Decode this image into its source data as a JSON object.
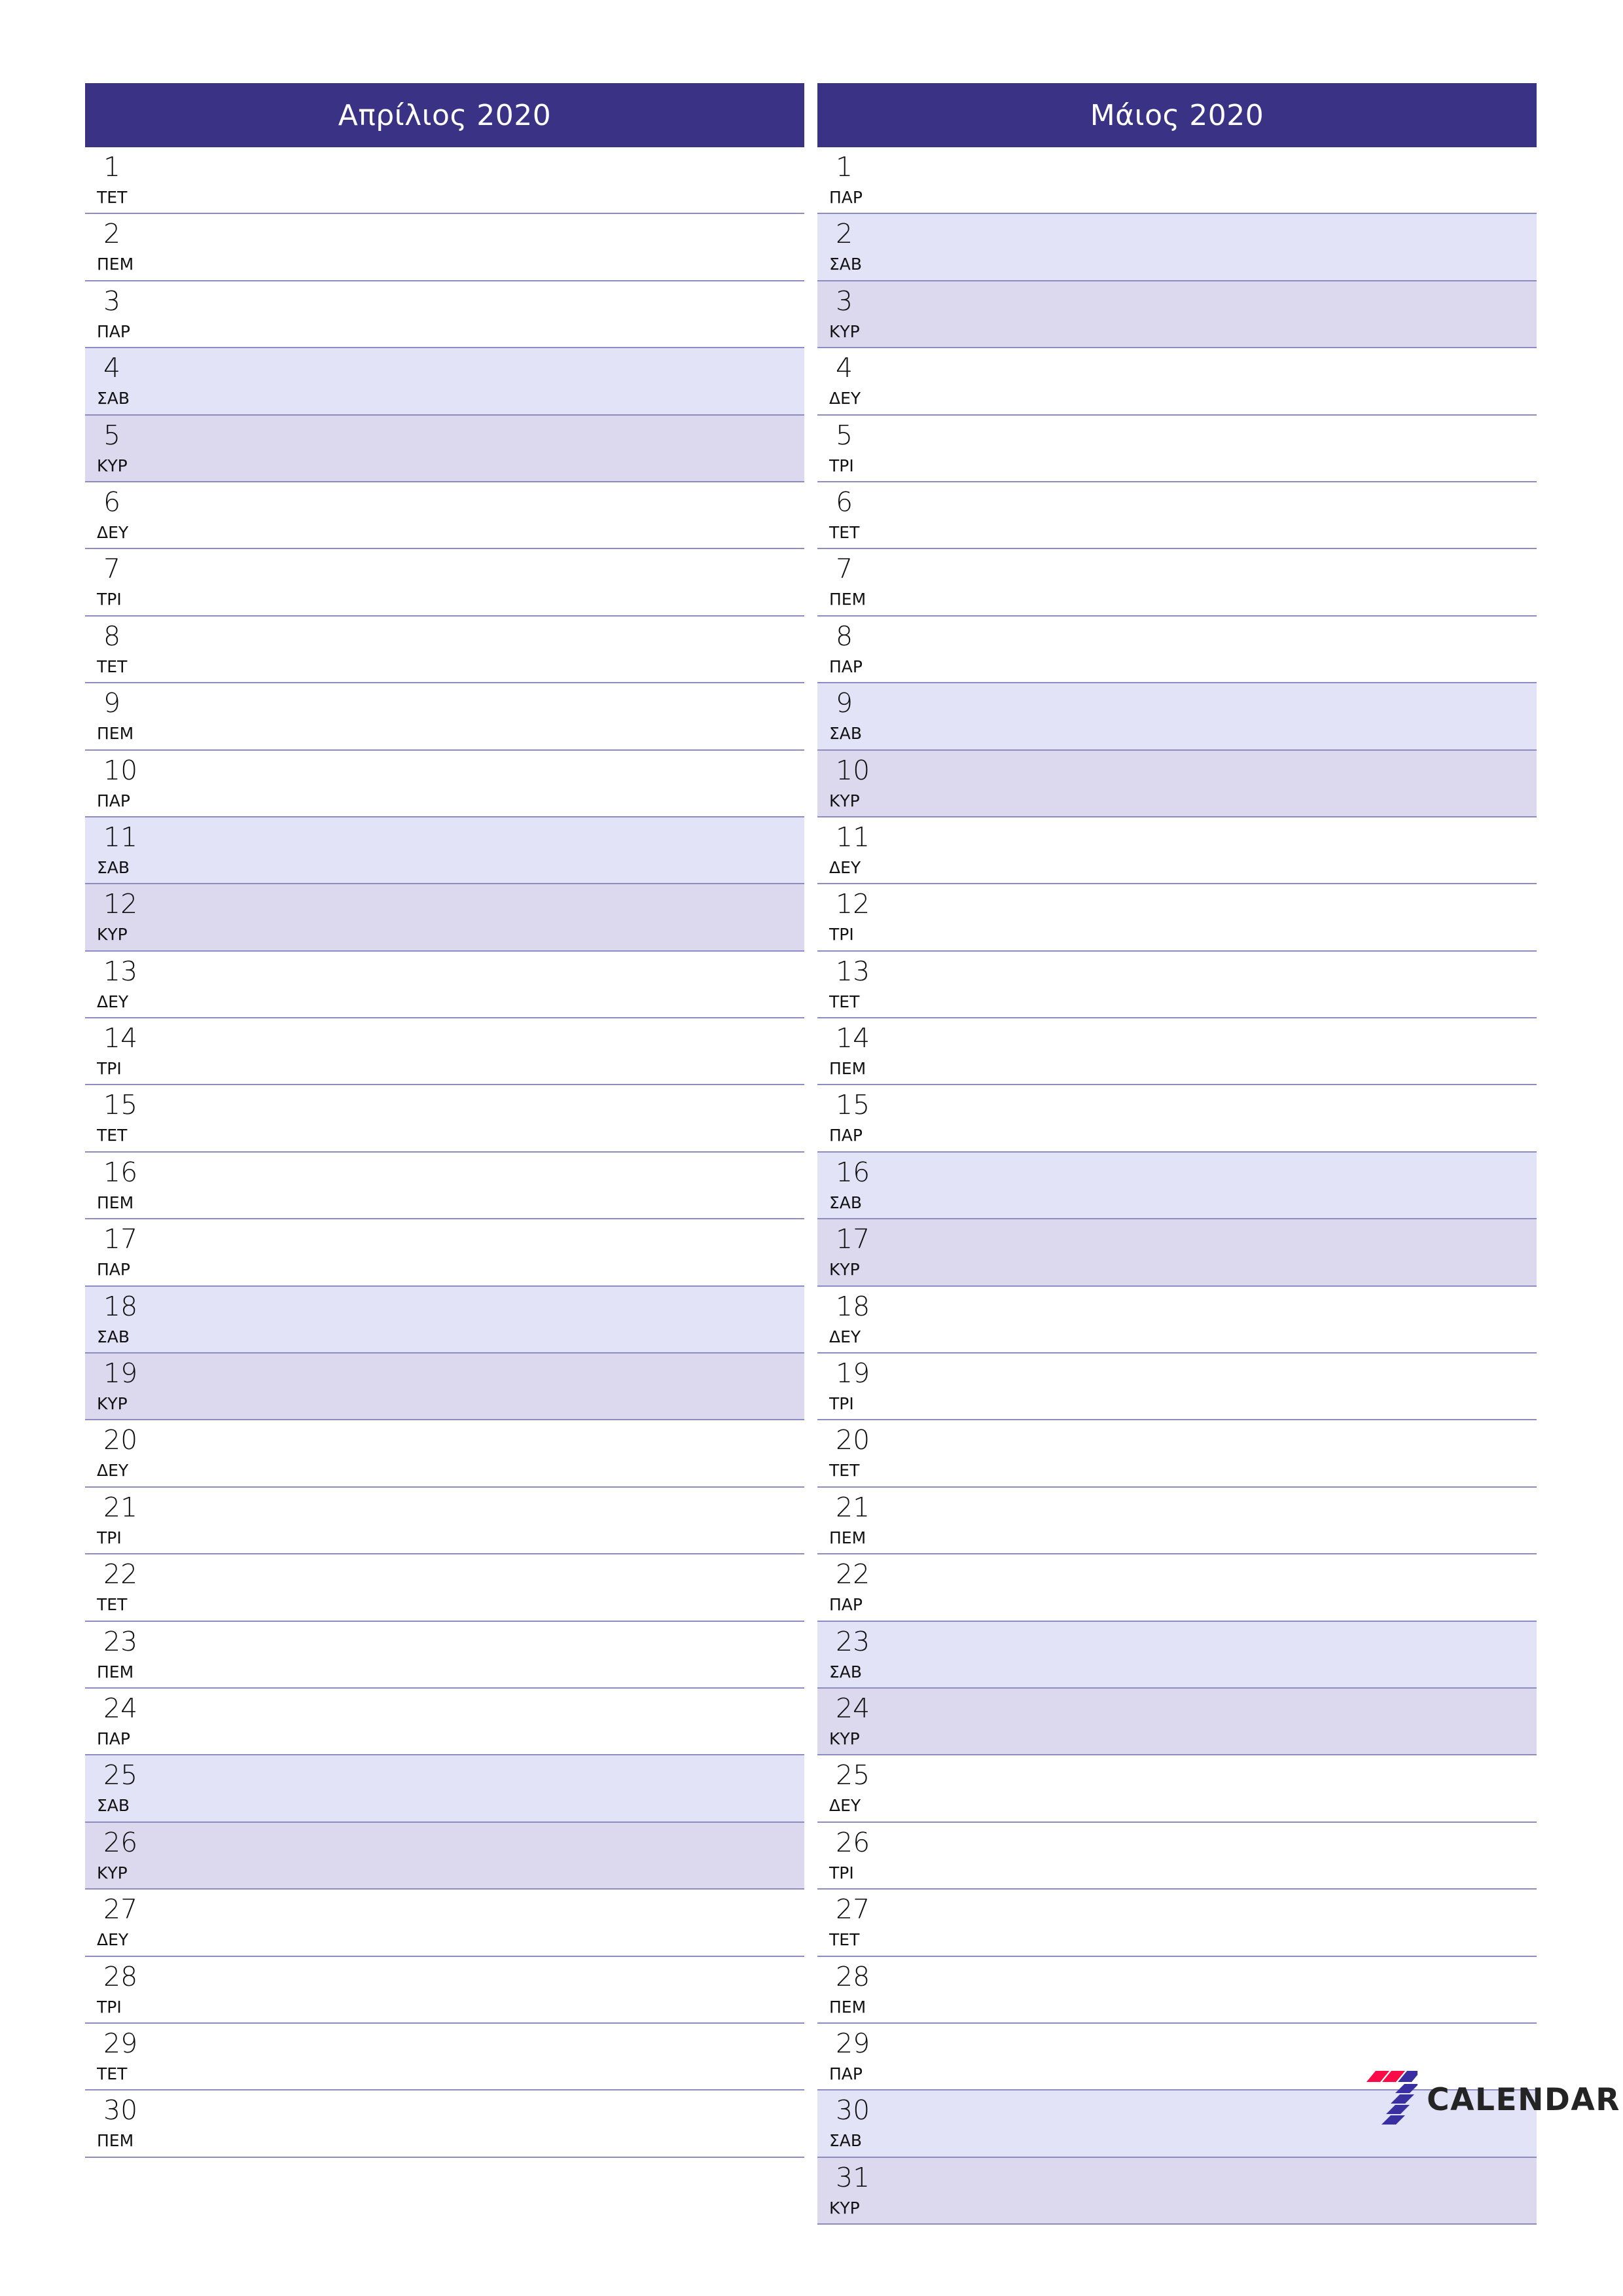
{
  "page": {
    "title": "Απρίλιος 2020 / Μάιος 2020 planner",
    "background": "#ffffff",
    "header_color": "#3a3285",
    "separator_color": "#8d8cc0",
    "saturday_color": "#e3e3f7",
    "sunday_color": "#dcd9ee"
  },
  "logo": {
    "name": "7calendar-logo",
    "text": "CALENDAR",
    "mark_red": "#fa0a46",
    "mark_indigo": "#3a2fa0"
  },
  "months": [
    {
      "title": "Απρίλιος 2020",
      "days": [
        {
          "num": "1",
          "dow": "ΤΕΤ",
          "type": "weekday"
        },
        {
          "num": "2",
          "dow": "ΠΕΜ",
          "type": "weekday"
        },
        {
          "num": "3",
          "dow": "ΠΑΡ",
          "type": "weekday"
        },
        {
          "num": "4",
          "dow": "ΣΑΒ",
          "type": "sat"
        },
        {
          "num": "5",
          "dow": "ΚΥΡ",
          "type": "sun"
        },
        {
          "num": "6",
          "dow": "ΔΕΥ",
          "type": "weekday"
        },
        {
          "num": "7",
          "dow": "ΤΡΙ",
          "type": "weekday"
        },
        {
          "num": "8",
          "dow": "ΤΕΤ",
          "type": "weekday"
        },
        {
          "num": "9",
          "dow": "ΠΕΜ",
          "type": "weekday"
        },
        {
          "num": "10",
          "dow": "ΠΑΡ",
          "type": "weekday"
        },
        {
          "num": "11",
          "dow": "ΣΑΒ",
          "type": "sat"
        },
        {
          "num": "12",
          "dow": "ΚΥΡ",
          "type": "sun"
        },
        {
          "num": "13",
          "dow": "ΔΕΥ",
          "type": "weekday"
        },
        {
          "num": "14",
          "dow": "ΤΡΙ",
          "type": "weekday"
        },
        {
          "num": "15",
          "dow": "ΤΕΤ",
          "type": "weekday"
        },
        {
          "num": "16",
          "dow": "ΠΕΜ",
          "type": "weekday"
        },
        {
          "num": "17",
          "dow": "ΠΑΡ",
          "type": "weekday"
        },
        {
          "num": "18",
          "dow": "ΣΑΒ",
          "type": "sat"
        },
        {
          "num": "19",
          "dow": "ΚΥΡ",
          "type": "sun"
        },
        {
          "num": "20",
          "dow": "ΔΕΥ",
          "type": "weekday"
        },
        {
          "num": "21",
          "dow": "ΤΡΙ",
          "type": "weekday"
        },
        {
          "num": "22",
          "dow": "ΤΕΤ",
          "type": "weekday"
        },
        {
          "num": "23",
          "dow": "ΠΕΜ",
          "type": "weekday"
        },
        {
          "num": "24",
          "dow": "ΠΑΡ",
          "type": "weekday"
        },
        {
          "num": "25",
          "dow": "ΣΑΒ",
          "type": "sat"
        },
        {
          "num": "26",
          "dow": "ΚΥΡ",
          "type": "sun"
        },
        {
          "num": "27",
          "dow": "ΔΕΥ",
          "type": "weekday"
        },
        {
          "num": "28",
          "dow": "ΤΡΙ",
          "type": "weekday"
        },
        {
          "num": "29",
          "dow": "ΤΕΤ",
          "type": "weekday"
        },
        {
          "num": "30",
          "dow": "ΠΕΜ",
          "type": "weekday"
        }
      ]
    },
    {
      "title": "Μάιος 2020",
      "days": [
        {
          "num": "1",
          "dow": "ΠΑΡ",
          "type": "weekday"
        },
        {
          "num": "2",
          "dow": "ΣΑΒ",
          "type": "sat"
        },
        {
          "num": "3",
          "dow": "ΚΥΡ",
          "type": "sun"
        },
        {
          "num": "4",
          "dow": "ΔΕΥ",
          "type": "weekday"
        },
        {
          "num": "5",
          "dow": "ΤΡΙ",
          "type": "weekday"
        },
        {
          "num": "6",
          "dow": "ΤΕΤ",
          "type": "weekday"
        },
        {
          "num": "7",
          "dow": "ΠΕΜ",
          "type": "weekday"
        },
        {
          "num": "8",
          "dow": "ΠΑΡ",
          "type": "weekday"
        },
        {
          "num": "9",
          "dow": "ΣΑΒ",
          "type": "sat"
        },
        {
          "num": "10",
          "dow": "ΚΥΡ",
          "type": "sun"
        },
        {
          "num": "11",
          "dow": "ΔΕΥ",
          "type": "weekday"
        },
        {
          "num": "12",
          "dow": "ΤΡΙ",
          "type": "weekday"
        },
        {
          "num": "13",
          "dow": "ΤΕΤ",
          "type": "weekday"
        },
        {
          "num": "14",
          "dow": "ΠΕΜ",
          "type": "weekday"
        },
        {
          "num": "15",
          "dow": "ΠΑΡ",
          "type": "weekday"
        },
        {
          "num": "16",
          "dow": "ΣΑΒ",
          "type": "sat"
        },
        {
          "num": "17",
          "dow": "ΚΥΡ",
          "type": "sun"
        },
        {
          "num": "18",
          "dow": "ΔΕΥ",
          "type": "weekday"
        },
        {
          "num": "19",
          "dow": "ΤΡΙ",
          "type": "weekday"
        },
        {
          "num": "20",
          "dow": "ΤΕΤ",
          "type": "weekday"
        },
        {
          "num": "21",
          "dow": "ΠΕΜ",
          "type": "weekday"
        },
        {
          "num": "22",
          "dow": "ΠΑΡ",
          "type": "weekday"
        },
        {
          "num": "23",
          "dow": "ΣΑΒ",
          "type": "sat"
        },
        {
          "num": "24",
          "dow": "ΚΥΡ",
          "type": "sun"
        },
        {
          "num": "25",
          "dow": "ΔΕΥ",
          "type": "weekday"
        },
        {
          "num": "26",
          "dow": "ΤΡΙ",
          "type": "weekday"
        },
        {
          "num": "27",
          "dow": "ΤΕΤ",
          "type": "weekday"
        },
        {
          "num": "28",
          "dow": "ΠΕΜ",
          "type": "weekday"
        },
        {
          "num": "29",
          "dow": "ΠΑΡ",
          "type": "weekday"
        },
        {
          "num": "30",
          "dow": "ΣΑΒ",
          "type": "sat"
        },
        {
          "num": "31",
          "dow": "ΚΥΡ",
          "type": "sun"
        }
      ]
    }
  ]
}
